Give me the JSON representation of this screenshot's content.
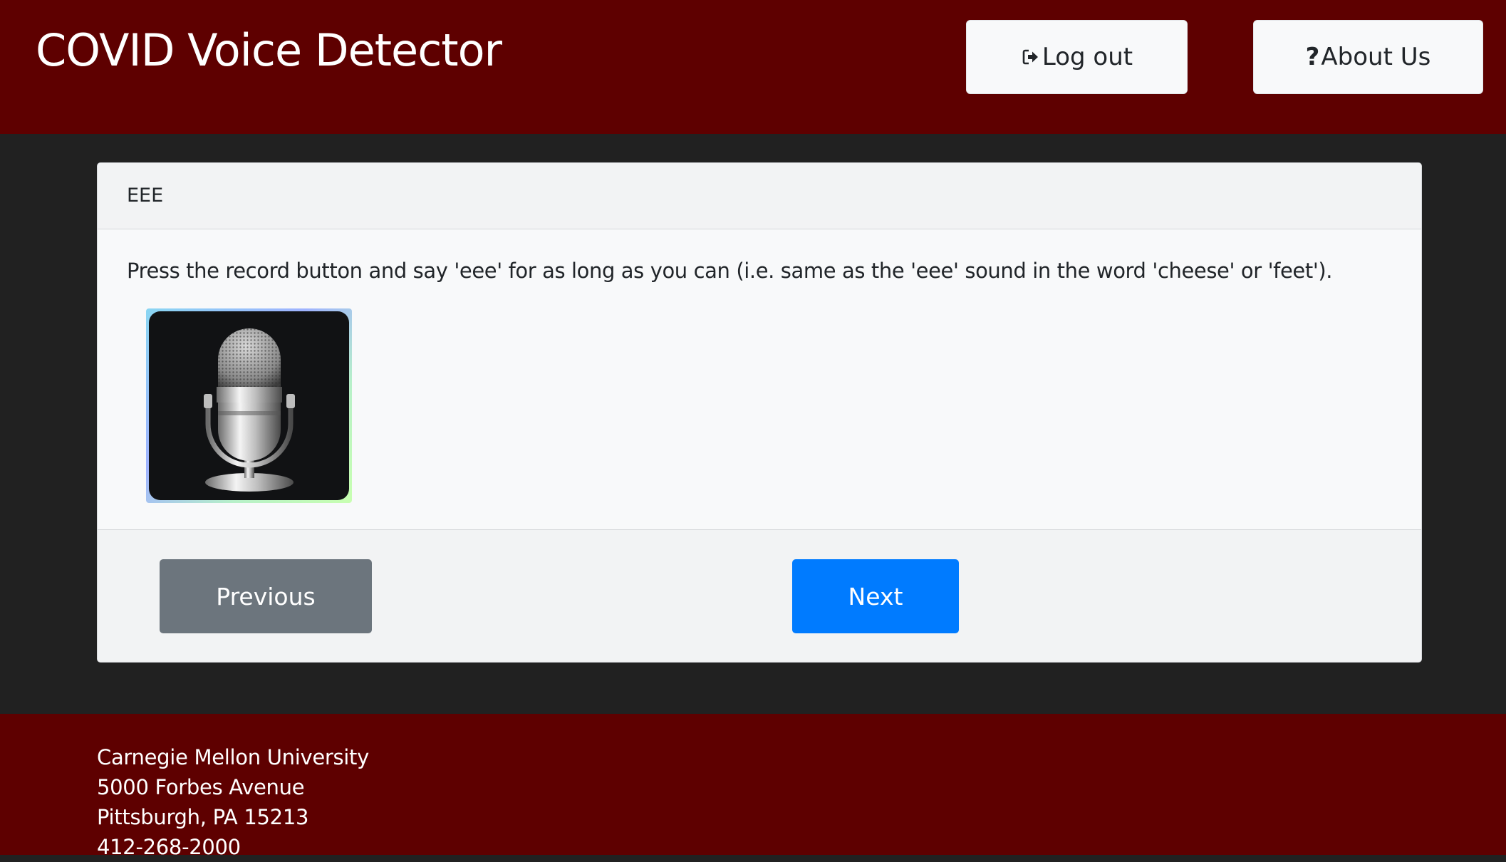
{
  "header": {
    "title": "COVID Voice Detector",
    "logout_label": "Log out",
    "about_label": "About Us",
    "about_icon_glyph": "?"
  },
  "card": {
    "title": "EEE",
    "instructions": "Press the record button and say 'eee' for as long as you can (i.e. same as the 'eee' sound in the word 'cheese' or 'feet').",
    "previous_label": "Previous",
    "next_label": "Next"
  },
  "footer": {
    "address_lines": [
      "Carnegie Mellon University",
      "5000 Forbes Avenue",
      "Pittsburgh, PA 15213",
      "412-268-2000"
    ]
  },
  "colors": {
    "brand": "#5e0000",
    "page_background": "#212121",
    "primary": "#007bff",
    "secondary": "#6c757d"
  },
  "icons": {
    "logout": "sign-out-icon",
    "about": "question-icon",
    "record": "microphone-icon"
  }
}
